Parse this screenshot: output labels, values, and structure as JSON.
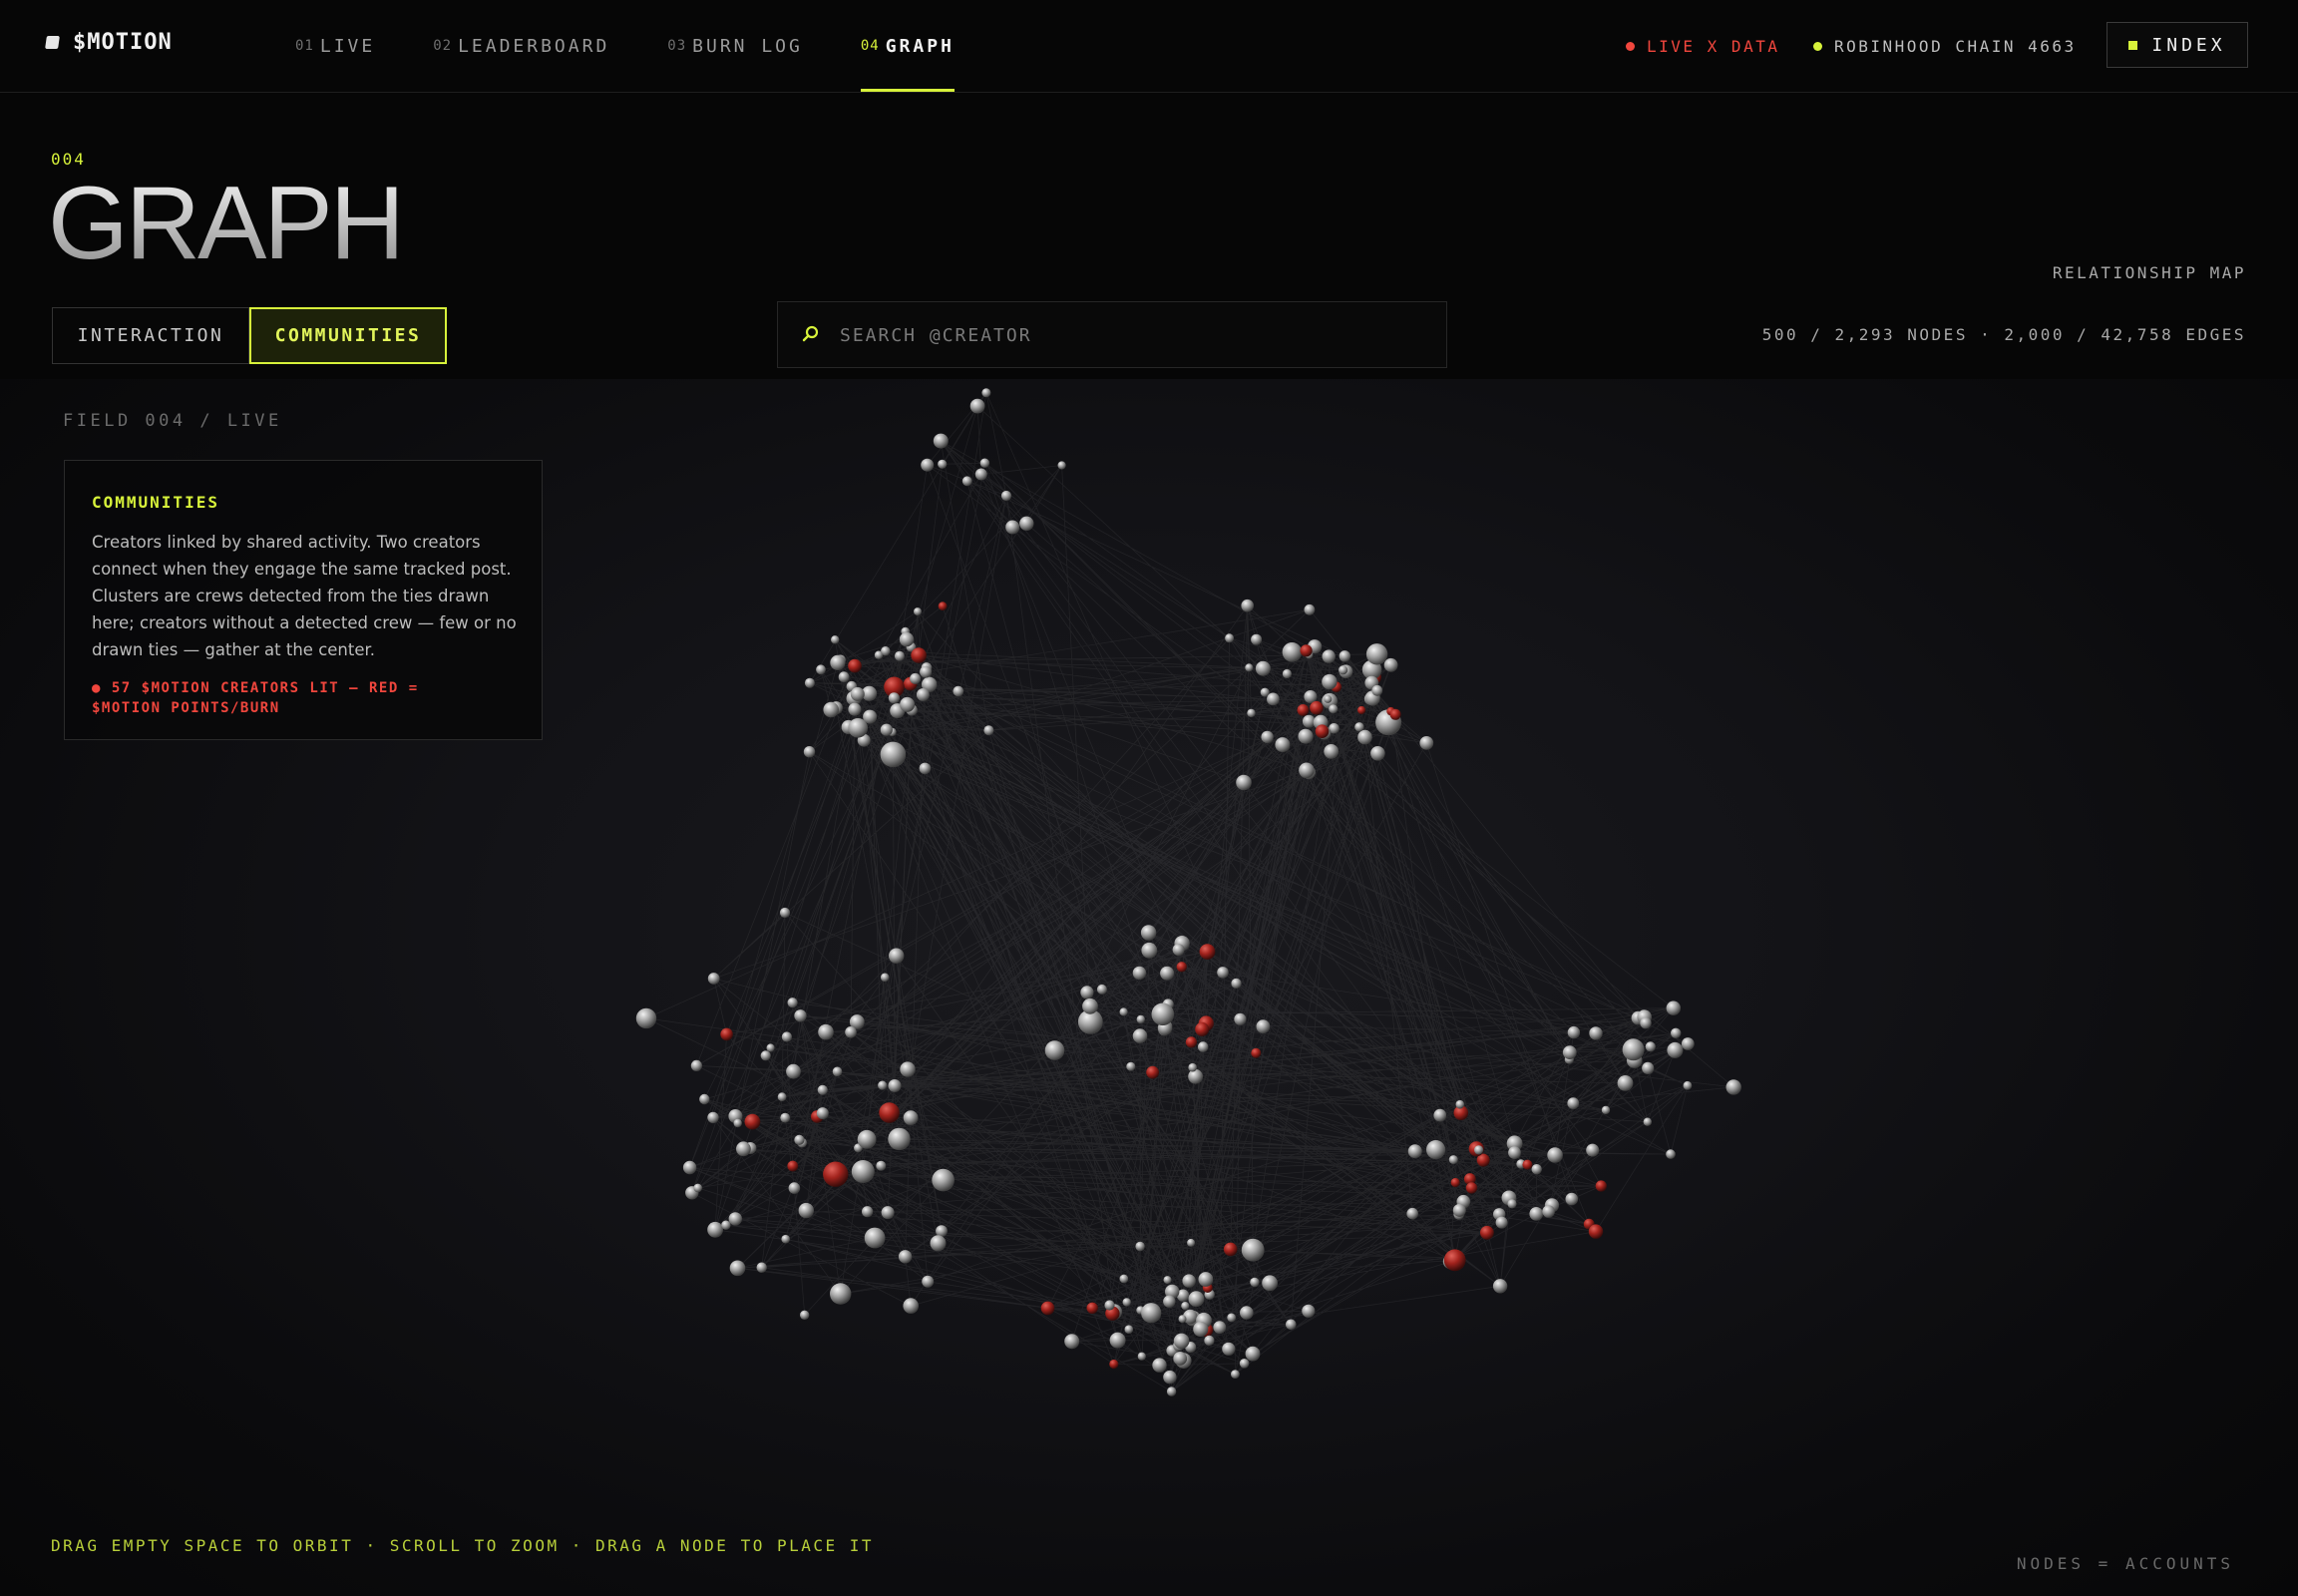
{
  "brand": {
    "name": "$MOTION",
    "icon": "brand-mark-icon"
  },
  "nav": {
    "tabs": [
      {
        "num": "01",
        "label": "LIVE",
        "active": false
      },
      {
        "num": "02",
        "label": "LEADERBOARD",
        "active": false
      },
      {
        "num": "03",
        "label": "BURN LOG",
        "active": false
      },
      {
        "num": "04",
        "label": "GRAPH",
        "active": true
      }
    ],
    "status_live": "LIVE X DATA",
    "status_chain": "ROBINHOOD CHAIN 4663",
    "index_label": "INDEX"
  },
  "header": {
    "eyebrow": "004",
    "title": "GRAPH",
    "relationship_map": "RELATIONSHIP MAP",
    "counts": "500 / 2,293 NODES · 2,000 / 42,758 EDGES"
  },
  "mode": {
    "interaction": "INTERACTION",
    "communities": "COMMUNITIES",
    "selected": "COMMUNITIES"
  },
  "search": {
    "placeholder": "SEARCH @CREATOR",
    "value": ""
  },
  "field": {
    "label": "FIELD 004 / LIVE"
  },
  "card": {
    "title": "COMMUNITIES",
    "description": "Creators linked by shared activity. Two creators connect when they engage the same tracked post. Clusters are crews detected from the ties drawn here; creators without a detected crew — few or no drawn ties — gather at the center.",
    "note": "● 57 $MOTION CREATORS LIT — RED = $MOTION POINTS/BURN"
  },
  "footer": {
    "hint": "DRAG EMPTY SPACE TO ORBIT · SCROLL TO ZOOM · DRAG A NODE TO PLACE IT",
    "legend": "NODES = ACCOUNTS"
  },
  "colors": {
    "accent": "#d7f23a",
    "live_red": "#f0463d",
    "node": "#b9b9b9",
    "node_lit": "#c0302a",
    "background": "#060606"
  }
}
